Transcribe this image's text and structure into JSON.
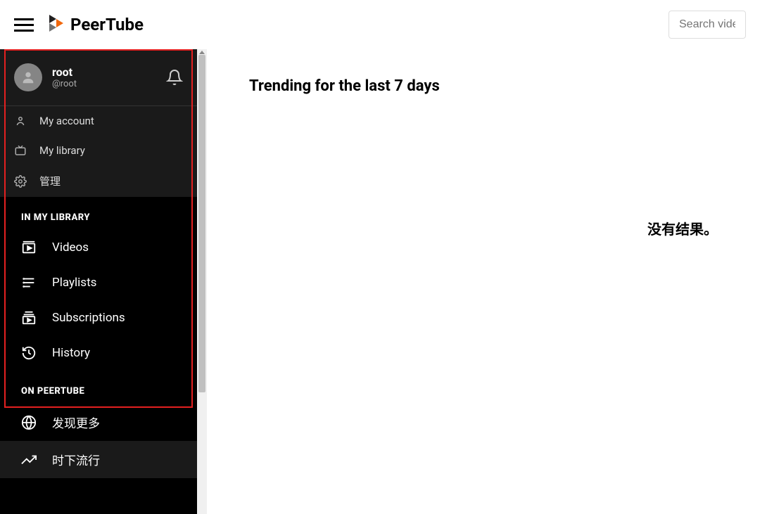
{
  "header": {
    "brand": "PeerTube",
    "search_placeholder": "Search videos,"
  },
  "user": {
    "name": "root",
    "handle": "@root"
  },
  "account_menu": [
    {
      "label": "My account",
      "icon": "user-icon"
    },
    {
      "label": "My library",
      "icon": "tv-icon"
    },
    {
      "label": "管理",
      "icon": "gear-icon"
    }
  ],
  "sections": {
    "library_title": "IN MY LIBRARY",
    "peertube_title": "ON PEERTUBE"
  },
  "library_items": [
    {
      "label": "Videos",
      "icon": "video-icon"
    },
    {
      "label": "Playlists",
      "icon": "playlist-icon"
    },
    {
      "label": "Subscriptions",
      "icon": "subscriptions-icon"
    },
    {
      "label": "History",
      "icon": "history-icon"
    }
  ],
  "peertube_items": [
    {
      "label": "发现更多",
      "icon": "globe-icon"
    },
    {
      "label": "时下流行",
      "icon": "trending-icon"
    }
  ],
  "main": {
    "title": "Trending for the last 7 days",
    "empty": "没有结果。"
  }
}
